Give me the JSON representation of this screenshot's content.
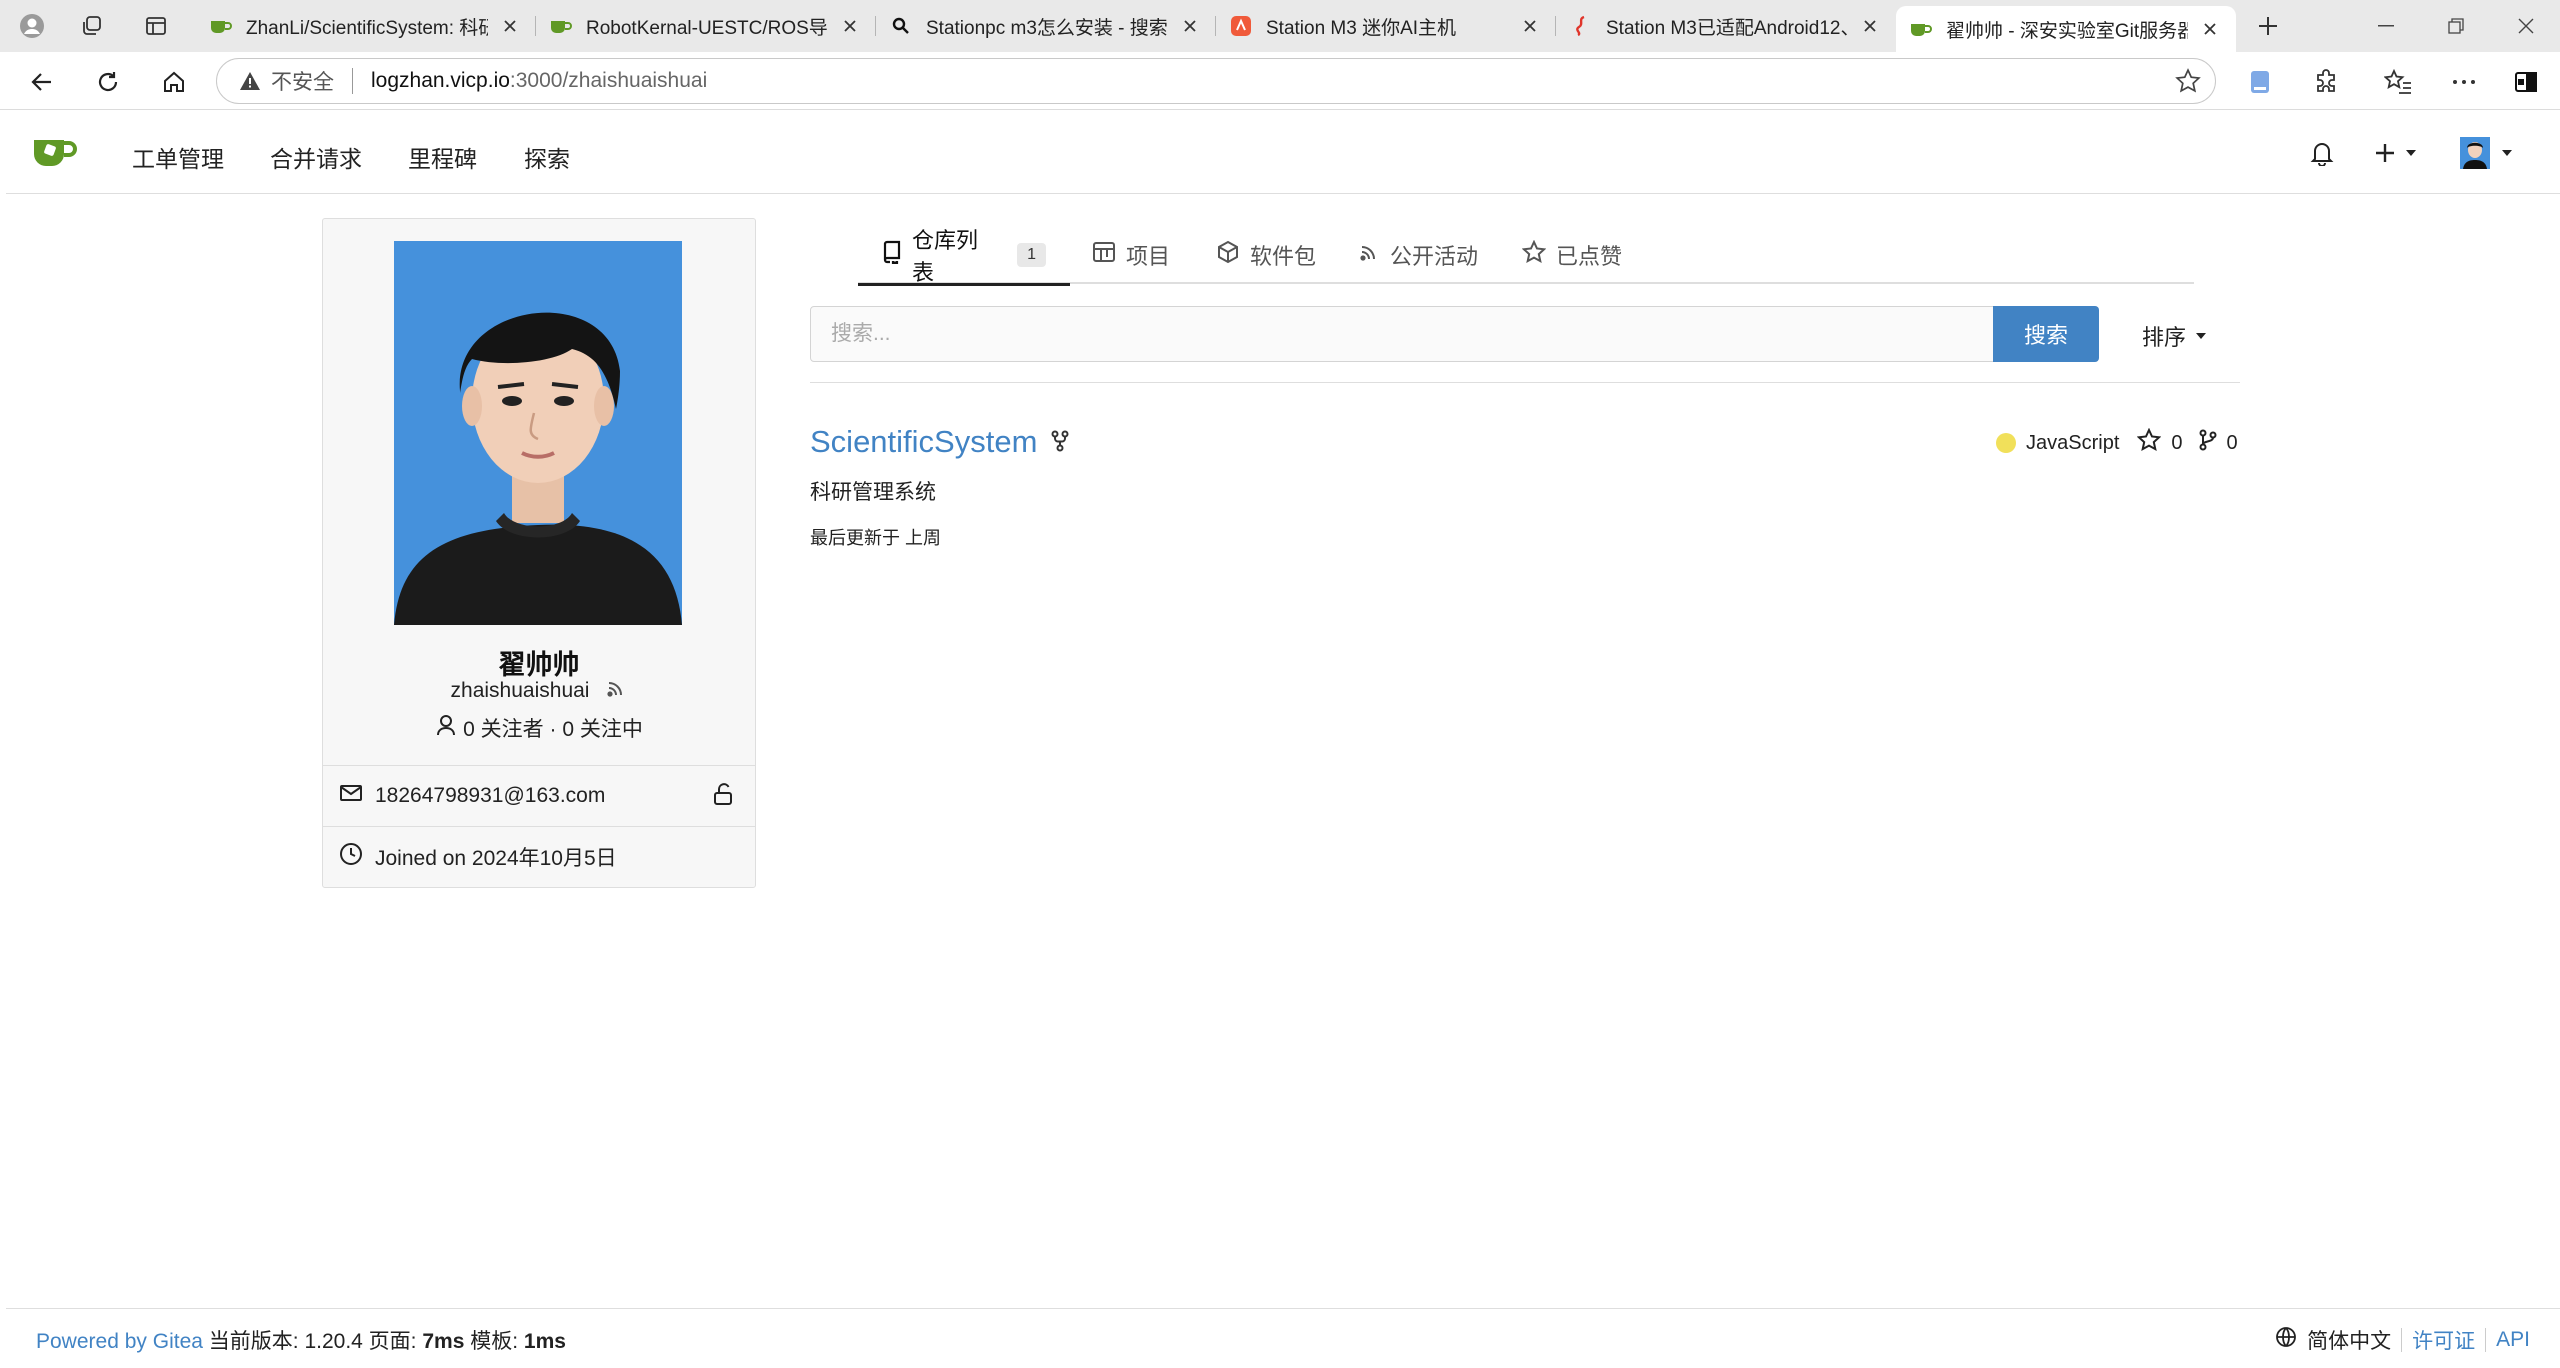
{
  "browser": {
    "tabs": [
      {
        "title": "ZhanLi/ScientificSystem: 科研管",
        "favicon": "gitea-icon",
        "active": false
      },
      {
        "title": "RobotKernal-UESTC/ROS导航机",
        "favicon": "gitea-icon",
        "active": false
      },
      {
        "title": "Stationpc m3怎么安装 - 搜索",
        "favicon": "search-icon",
        "active": false
      },
      {
        "title": "Station M3 迷你AI主机",
        "favicon": "station-icon",
        "active": false
      },
      {
        "title": "Station M3已适配Android12、",
        "favicon": "station-icon",
        "active": false
      },
      {
        "title": "翟帅帅 - 深安实验室Git服务器",
        "favicon": "gitea-icon",
        "active": true
      }
    ],
    "address": {
      "security_label": "不安全",
      "host": "logzhan.vicp.io",
      "path": ":3000/zhaishuaishuai"
    }
  },
  "nav": {
    "items": [
      "工单管理",
      "合并请求",
      "里程碑",
      "探索"
    ]
  },
  "profile": {
    "full_name": "翟帅帅",
    "login": "zhaishuaishuai",
    "follow_text": "0 关注者 · 0 关注中",
    "email": "18264798931@163.com",
    "joined": "Joined on 2024年10月5日"
  },
  "tabs": [
    {
      "label": "仓库列表",
      "count": "1",
      "icon": "repo-icon",
      "active": true
    },
    {
      "label": "项目",
      "icon": "project-icon",
      "active": false
    },
    {
      "label": "软件包",
      "icon": "package-icon",
      "active": false
    },
    {
      "label": "公开活动",
      "icon": "rss-icon",
      "active": false
    },
    {
      "label": "已点赞",
      "icon": "star-icon",
      "active": false
    }
  ],
  "search": {
    "placeholder": "搜索...",
    "button": "搜索",
    "sort": "排序"
  },
  "repos": [
    {
      "name": "ScientificSystem",
      "description": "科研管理系统",
      "updated": "最后更新于 上周",
      "language": "JavaScript",
      "language_color": "#f1e05a",
      "stars": "0",
      "forks": "0"
    }
  ],
  "footer": {
    "powered": "Powered by Gitea",
    "version_text": "当前版本: 1.20.4 页面: ",
    "page_time": "7ms",
    "template_label": " 模板: ",
    "template_time": "1ms",
    "language": "简体中文",
    "license": "许可证",
    "api": "API"
  },
  "colors": {
    "link": "#4183c4",
    "photo_bg": "#4591dc",
    "gitea_green": "#609926"
  }
}
